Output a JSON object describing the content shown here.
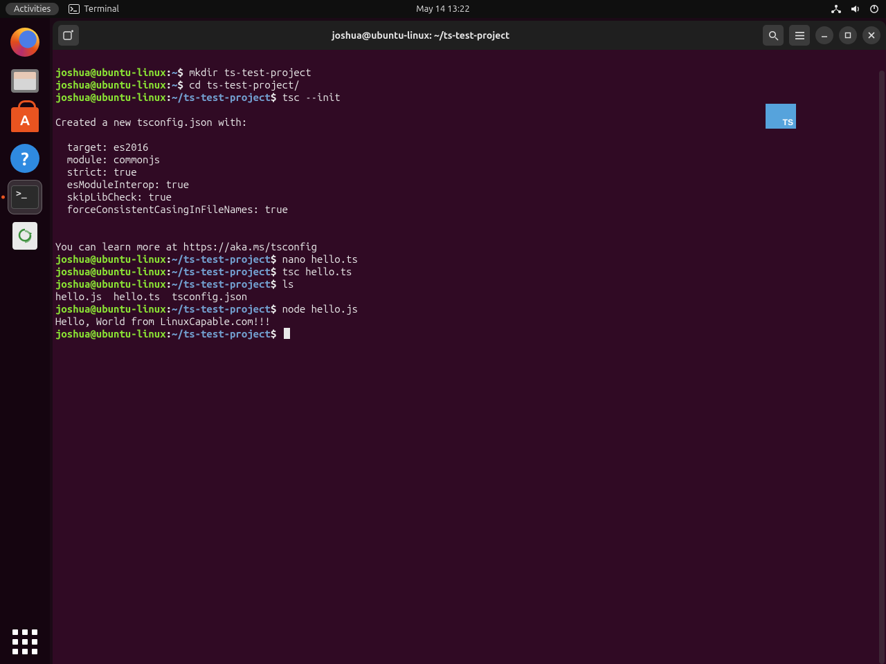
{
  "topbar": {
    "activities": "Activities",
    "app_label": "Terminal",
    "clock": "May 14  13:22"
  },
  "window": {
    "title": "joshua@ubuntu-linux: ~/ts-test-project"
  },
  "prompt": {
    "user_host": "joshua@ubuntu-linux",
    "home_path": "~",
    "project_path": "~/ts-test-project",
    "sigil": "$"
  },
  "ts_badge": "TS",
  "term": {
    "cmd_mkdir": "mkdir ts-test-project",
    "cmd_cd": "cd ts-test-project/",
    "cmd_tsc_init": "tsc --init",
    "blank": "",
    "out_created": "Created a new tsconfig.json with:",
    "out_opts": [
      "  target: es2016",
      "  module: commonjs",
      "  strict: true",
      "  esModuleInterop: true",
      "  skipLibCheck: true",
      "  forceConsistentCasingInFileNames: true"
    ],
    "out_learn": "You can learn more at https://aka.ms/tsconfig",
    "cmd_nano": "nano hello.ts",
    "cmd_tsc": "tsc hello.ts",
    "cmd_ls": "ls",
    "out_ls": "hello.js  hello.ts  tsconfig.json",
    "cmd_node": "node hello.js",
    "out_hello": "Hello, World from LinuxCapable.com!!!"
  }
}
